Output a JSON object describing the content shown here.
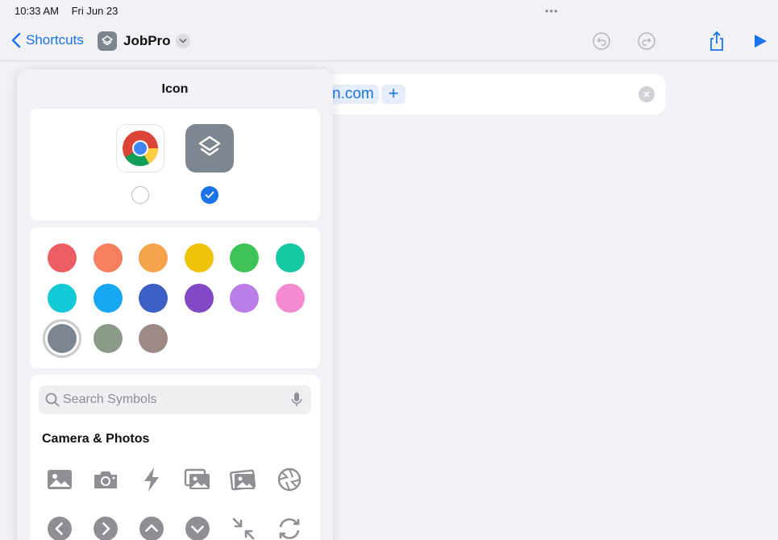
{
  "status": {
    "time": "10:33 AM",
    "date": "Fri Jun 23",
    "multitask": "•••"
  },
  "nav": {
    "back_label": "Shortcuts",
    "title": "JobPro"
  },
  "editor": {
    "url_fragment": "n.com",
    "add_label": "+"
  },
  "popover": {
    "title": "Icon",
    "search_placeholder": "Search Symbols",
    "category": "Camera & Photos"
  },
  "icon_options": [
    {
      "name": "chrome-icon",
      "selected": false
    },
    {
      "name": "shortcut-layers-icon",
      "selected": true
    }
  ],
  "colors": [
    "#ec5d63",
    "#f4805f",
    "#f5a44d",
    "#edc30c",
    "#3fc359",
    "#14c8a0",
    "#14c9d6",
    "#17a7f0",
    "#3d60c4",
    "#8149c4",
    "#ba7ee6",
    "#f48ad0",
    "#7c8590",
    "#8c9a8a",
    "#9c8a86"
  ],
  "selected_color": "#7c8590",
  "symbols_row1": [
    "photo-icon",
    "camera-icon",
    "bolt-icon",
    "photo-stack-icon",
    "photos-icon",
    "aperture-icon"
  ],
  "symbols_row2": [
    "chevron-left-circle-icon",
    "chevron-right-circle-icon",
    "chevron-up-circle-icon",
    "chevron-down-circle-icon",
    "arrows-collapse-icon",
    "arrow-refresh-icon"
  ]
}
